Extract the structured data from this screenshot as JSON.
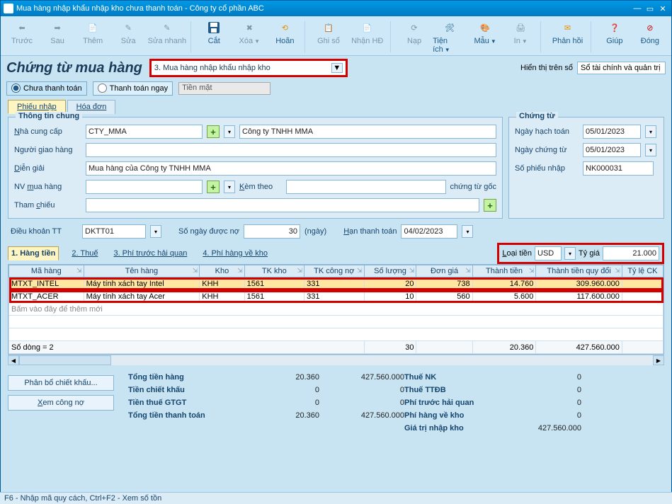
{
  "title": "Mua hàng nhập khẩu nhập kho chưa thanh toán - Công ty cổ phần ABC",
  "ribbon": {
    "prev": "Trước",
    "next": "Sau",
    "add": "Thêm",
    "edit": "Sửa",
    "quick": "Sửa nhanh",
    "cut": "Cắt",
    "del": "Xóa",
    "undo": "Hoãn",
    "post": "Ghi sổ",
    "recv": "Nhận HĐ",
    "load": "Nạp",
    "util": "Tiện ích",
    "tpl": "Mẫu",
    "print": "In",
    "fb": "Phản hồi",
    "help": "Giúp",
    "close": "Đóng"
  },
  "header": {
    "heading": "Chứng từ mua hàng",
    "mode": "3. Mua hàng nhập khẩu nhập kho",
    "rightlabel": "Hiển thị trên sổ",
    "rightvalue": "Sổ tài chính và quản trị"
  },
  "radio": {
    "r1": "Chưa thanh toán",
    "r2": "Thanh toán ngay",
    "cash": "Tiền mặt"
  },
  "tabs": {
    "t1": "Phiếu nhập",
    "t2": "Hóa đơn"
  },
  "info": {
    "legend": "Thông tin chung",
    "supplier_l": "Nhà cung cấp",
    "supplier": "CTY_MMA",
    "supplier_name": "Công ty TNHH MMA",
    "deliverer_l": "Người giao hàng",
    "deliverer": "",
    "desc_l": "Diễn giải",
    "desc": "Mua hàng của Công ty TNHH MMA",
    "emp_l": "NV mua hàng",
    "emp": "",
    "attach_l": "Kèm theo",
    "attach": "",
    "attach_suffix": "chứng từ gốc",
    "ref_l": "Tham chiếu"
  },
  "voucher": {
    "legend": "Chứng từ",
    "acc_l": "Ngày hạch toán",
    "acc": "05/01/2023",
    "voucher_l": "Ngày chứng từ",
    "voucher": "05/01/2023",
    "no_l": "Số phiếu nhập",
    "no": "NK000031"
  },
  "terms": {
    "term_l": "Điều khoản TT",
    "term": "DKTT01",
    "days_l": "Số ngày được nợ",
    "days": "30",
    "days_unit": "(ngày)",
    "due_l": "Hạn thanh toán",
    "due": "04/02/2023"
  },
  "gridtabs": {
    "g1": "1. Hàng tiền",
    "g2": "2. Thuế",
    "g3": "3. Phí trước hải quan",
    "g4": "4. Phí hàng về kho"
  },
  "rate": {
    "cur_l": "Loại tiền",
    "cur": "USD",
    "rate_l": "Tỷ giá",
    "rate": "21.000"
  },
  "cols": {
    "c1": "Mã hàng",
    "c2": "Tên hàng",
    "c3": "Kho",
    "c4": "TK kho",
    "c5": "TK công nợ",
    "c6": "Số lượng",
    "c7": "Đơn giá",
    "c8": "Thành tiền",
    "c9": "Thành tiền quy đổi",
    "c10": "Tỷ lệ CK"
  },
  "rows": [
    {
      "code": "MTXT_INTEL",
      "name": "Máy tính xách tay Intel",
      "wh": "KHH",
      "invacc": "1561",
      "apacc": "331",
      "qty": "20",
      "price": "738",
      "amt": "14.760",
      "amt_conv": "309.960.000"
    },
    {
      "code": "MTXT_ACER",
      "name": "Máy tính xách tay Acer",
      "wh": "KHH",
      "invacc": "1561",
      "apacc": "331",
      "qty": "10",
      "price": "560",
      "amt": "5.600",
      "amt_conv": "117.600.000"
    }
  ],
  "addrow": "Bấm vào đây để thêm mới",
  "foot": {
    "count": "Số dòng = 2",
    "qty": "30",
    "amt": "20.360",
    "amt_conv": "427.560.000"
  },
  "btns": {
    "alloc": "Phân bổ chiết khấu...",
    "debt": "Xem công nợ"
  },
  "totals": {
    "goods_l": "Tổng tiền hàng",
    "goods": "20.360",
    "goods_conv": "427.560.000",
    "disc_l": "Tiền chiết khấu",
    "disc": "0",
    "disc_conv": "0",
    "vat_l": "Tiền thuế GTGT",
    "vat": "0",
    "vat_conv": "0",
    "pay_l": "Tổng tiền thanh toán",
    "pay": "20.360",
    "pay_conv": "427.560.000",
    "impduty_l": "Thuế NK",
    "impduty": "0",
    "excise_l": "Thuế TTĐB",
    "excise": "0",
    "prefee_l": "Phí trước hải quan",
    "prefee": "0",
    "whfee_l": "Phí hàng về kho",
    "whfee": "0",
    "inval_l": "Giá trị nhập kho",
    "inval": "427.560.000"
  },
  "status": "F6 - Nhập mã quy cách, Ctrl+F2 - Xem số tồn"
}
